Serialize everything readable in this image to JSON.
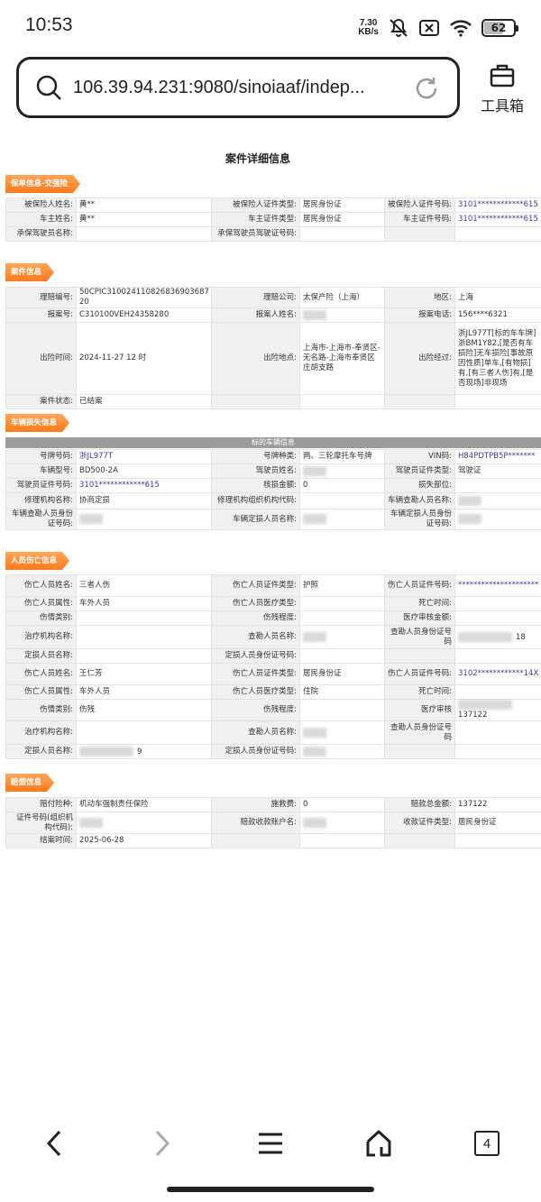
{
  "status": {
    "time": "10:53",
    "net_speed_value": "7.30",
    "net_speed_unit": "KB/s",
    "battery": "62",
    "battery_level": 0.62
  },
  "browser": {
    "url": "106.39.94.231:9080/sinoiaaf/indep...",
    "toolbox_label": "工具箱",
    "tab_count": "4"
  },
  "page": {
    "title": "案件详细信息",
    "sections": {
      "policy": "保单信息-交强险",
      "case": "案件信息",
      "vehicle": "车辆损失信息",
      "injury": "人员伤亡信息",
      "compensation": "赔偿信息"
    },
    "vehicle_subheader": "标的车辆信息",
    "policy_rows": [
      [
        "被保险人姓名:",
        "黄**",
        "被保险人证件类型:",
        "居民身份证",
        "被保险人证件号码:",
        "3101************615"
      ],
      [
        "车主姓名:",
        "黄**",
        "车主证件类型:",
        "居民身份证",
        "车主证件号码:",
        "3101************615"
      ],
      [
        "承保驾驶员名称:",
        "",
        "承保驾驶员驾驶证号码:",
        "",
        "",
        ""
      ]
    ],
    "case_rows": [
      [
        "理赔编号:",
        "50CPIC310024110826836903687 20",
        "理赔公司:",
        "太保产险（上海）",
        "地区:",
        "上海"
      ],
      [
        "报案号:",
        "C310100VEH24358280",
        "报案人姓名:",
        "",
        "报案电话:",
        "156****6321"
      ],
      [
        "出险时间:",
        "2024-11-27 12 时",
        "出险地点:",
        "上海市-上海市-奉贤区-无名路-上海市奉贤区庄胡支路",
        "出险经过:",
        "浙JL977T[标的车车牌]浙BM1Y82,[是否有车损险]无车损险[事故原因性质]单车,[有物损]有,[有三者人伤]有,[是否现场]非现场"
      ],
      [
        "案件状态:",
        "已结案",
        "",
        "",
        "",
        ""
      ]
    ],
    "vehicle_rows": [
      [
        "号牌号码:",
        "浙JL977T",
        "号牌种类:",
        "两、三轮摩托车号牌",
        "VIN码:",
        "H84PDTPB5P*******"
      ],
      [
        "车辆型号:",
        "BD500-2A",
        "驾驶员姓名:",
        "",
        "驾驶员证件类型:",
        "驾驶证"
      ],
      [
        "驾驶员证件号码:",
        "3101************615",
        "核损金额:",
        "0",
        "损失部位:",
        ""
      ],
      [
        "修理机构名称:",
        "协商定损",
        "修理机构组织机构代码:",
        "",
        "车辆查勘人员名称:",
        ""
      ],
      [
        "车辆查勘人员身份证号码:",
        "",
        "车辆定损人员名称:",
        "",
        "车辆定损人员身份证号码:",
        ""
      ]
    ],
    "injury_rows": [
      [
        "伤亡人员姓名:",
        "三者人伤",
        "伤亡人员证件类型:",
        "护照",
        "伤亡人员证件号码:",
        "*********************"
      ],
      [
        "伤亡人员属性:",
        "车外人员",
        "伤亡人员医疗类型:",
        "",
        "死亡时间:",
        ""
      ],
      [
        "伤情类别:",
        "",
        "伤残程度:",
        "",
        "医疗审核金额:",
        ""
      ],
      [
        "治疗机构名称:",
        "",
        "查勘人员名称:",
        "",
        "查勘人员身份证号码",
        "18"
      ],
      [
        "定损人员名称:",
        "",
        "定损人员身份证号码:",
        "",
        "",
        ""
      ],
      [
        "伤亡人员姓名:",
        "王仁芳",
        "伤亡人员证件类型:",
        "居民身份证",
        "伤亡人员证件号码:",
        "3102************14X"
      ],
      [
        "伤亡人员属性:",
        "车外人员",
        "伤亡人员医疗类型:",
        "住院",
        "死亡时间:",
        ""
      ],
      [
        "伤情类别:",
        "伤残",
        "伤残程度:",
        "",
        "医疗审核",
        "137122"
      ],
      [
        "治疗机构名称:",
        "",
        "查勘人员名称:",
        "",
        "查勘人员身份证号码",
        ""
      ],
      [
        "定损人员名称:",
        "9",
        "定损人员身份证号码:",
        "",
        "",
        ""
      ]
    ],
    "comp_rows": [
      [
        "赔付险种:",
        "机动车强制责任保险",
        "施救费:",
        "0",
        "赔款总金额:",
        "137122"
      ],
      [
        "证件号码(组织机构代码):",
        "",
        "赔款收款账户名:",
        "",
        "收款证件类型:",
        "居民身份证"
      ],
      [
        "结案时间:",
        "2025-06-28",
        "",
        "",
        "",
        ""
      ]
    ]
  }
}
